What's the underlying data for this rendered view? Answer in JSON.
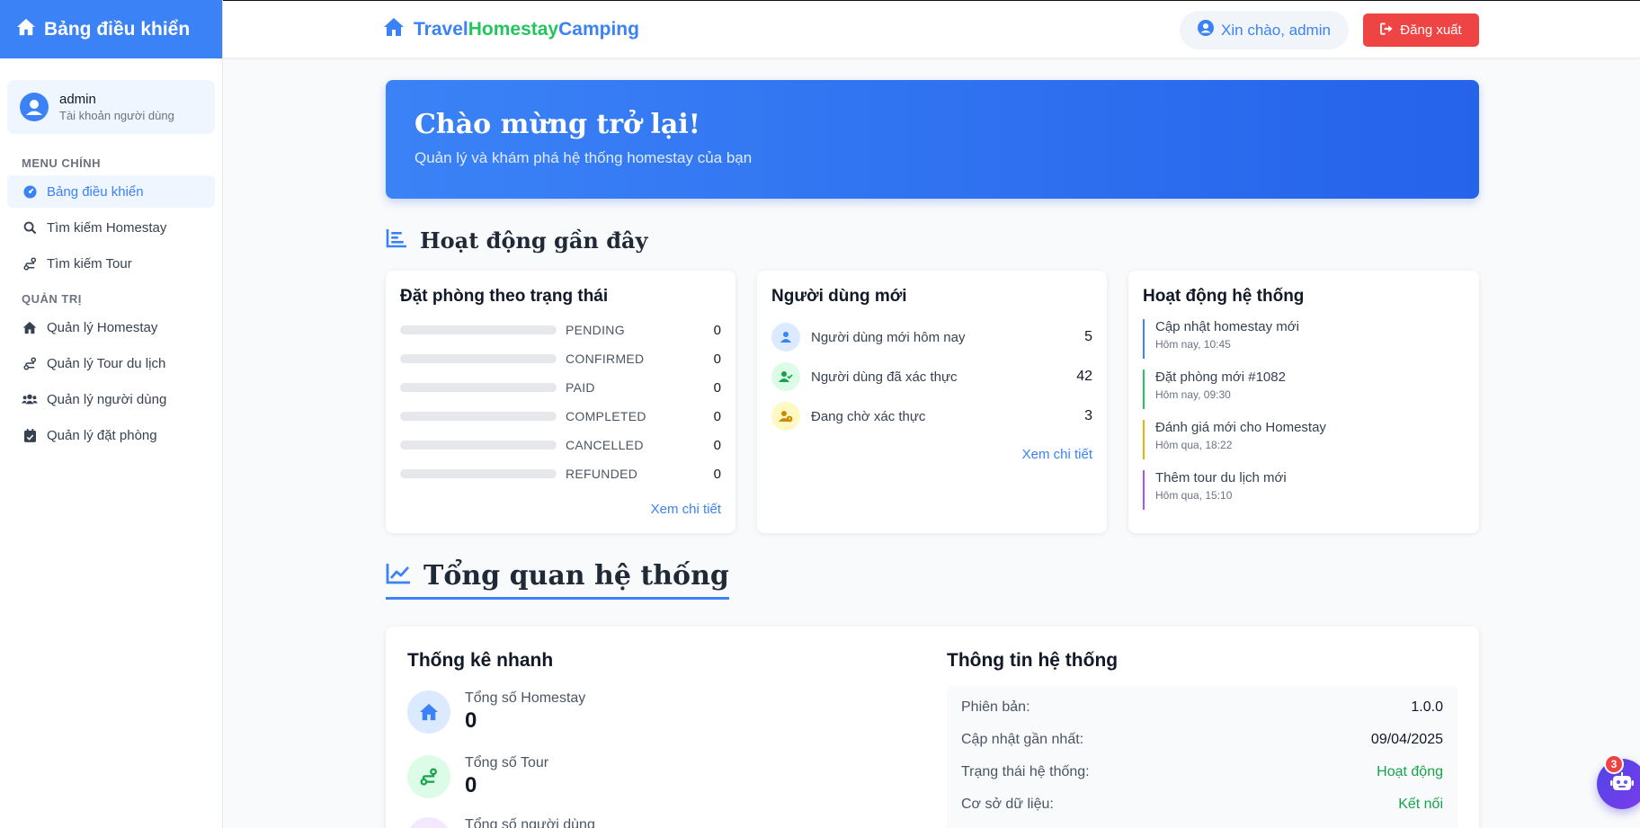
{
  "sidebar": {
    "title": "Bảng điều khiển",
    "user": {
      "name": "admin",
      "role": "Tài khoản người dùng"
    },
    "section_main": "MENU CHÍNH",
    "main_items": [
      {
        "label": "Bảng điều khiển",
        "icon": "dashboard-icon"
      },
      {
        "label": "Tìm kiếm Homestay",
        "icon": "search-icon"
      },
      {
        "label": "Tìm kiếm Tour",
        "icon": "route-icon"
      }
    ],
    "section_admin": "QUẢN TRỊ",
    "admin_items": [
      {
        "label": "Quản lý Homestay",
        "icon": "home-icon"
      },
      {
        "label": "Quản lý Tour du lịch",
        "icon": "route-icon"
      },
      {
        "label": "Quản lý người dùng",
        "icon": "users-icon"
      },
      {
        "label": "Quản lý đặt phòng",
        "icon": "calendar-check-icon"
      }
    ]
  },
  "topbar": {
    "brand_part1": "Travel",
    "brand_part2": "Homestay",
    "brand_part3": "Camping",
    "greeting": "Xin chào, admin",
    "logout": "Đăng xuất"
  },
  "hero": {
    "title": "Chào mừng trở lại!",
    "subtitle": "Quản lý và khám phá hệ thống homestay của bạn"
  },
  "recent": {
    "title": "Hoạt động gần đây",
    "booking_status": {
      "title": "Đặt phòng theo trạng thái",
      "rows": [
        {
          "label": "PENDING",
          "value": "0"
        },
        {
          "label": "CONFIRMED",
          "value": "0"
        },
        {
          "label": "PAID",
          "value": "0"
        },
        {
          "label": "COMPLETED",
          "value": "0"
        },
        {
          "label": "CANCELLED",
          "value": "0"
        },
        {
          "label": "REFUNDED",
          "value": "0"
        }
      ],
      "link": "Xem chi tiết"
    },
    "new_users": {
      "title": "Người dùng mới",
      "rows": [
        {
          "label": "Người dùng mới hôm nay",
          "value": "5"
        },
        {
          "label": "Người dùng đã xác thực",
          "value": "42"
        },
        {
          "label": "Đang chờ xác thực",
          "value": "3"
        }
      ],
      "link": "Xem chi tiết"
    },
    "system_activity": {
      "title": "Hoạt động hệ thống",
      "items": [
        {
          "title": "Cập nhật homestay mới",
          "time": "Hôm nay, 10:45",
          "color": "#3b82f6"
        },
        {
          "title": "Đặt phòng mới #1082",
          "time": "Hôm nay, 09:30",
          "color": "#22c55e"
        },
        {
          "title": "Đánh giá mới cho Homestay",
          "time": "Hôm qua, 18:22",
          "color": "#eab308"
        },
        {
          "title": "Thêm tour du lịch mới",
          "time": "Hôm qua, 15:10",
          "color": "#a855f7"
        }
      ]
    }
  },
  "overview": {
    "title": "Tổng quan hệ thống",
    "quick_stats": {
      "title": "Thống kê nhanh",
      "items": [
        {
          "label": "Tổng số Homestay",
          "value": "0"
        },
        {
          "label": "Tổng số Tour",
          "value": "0"
        },
        {
          "label": "Tổng số người dùng",
          "value": ""
        }
      ]
    },
    "system_info": {
      "title": "Thông tin hệ thống",
      "rows": [
        {
          "label": "Phiên bản:",
          "value": "1.0.0"
        },
        {
          "label": "Cập nhật gần nhất:",
          "value": "09/04/2025"
        },
        {
          "label": "Trạng thái hệ thống:",
          "value": "Hoạt động"
        },
        {
          "label": "Cơ sở dữ liệu:",
          "value": "Kết nối"
        }
      ]
    }
  },
  "chatbot": {
    "badge": "3"
  },
  "colors": {
    "primary": "#3b82f6",
    "danger": "#ef4444",
    "success": "#16a34a"
  }
}
